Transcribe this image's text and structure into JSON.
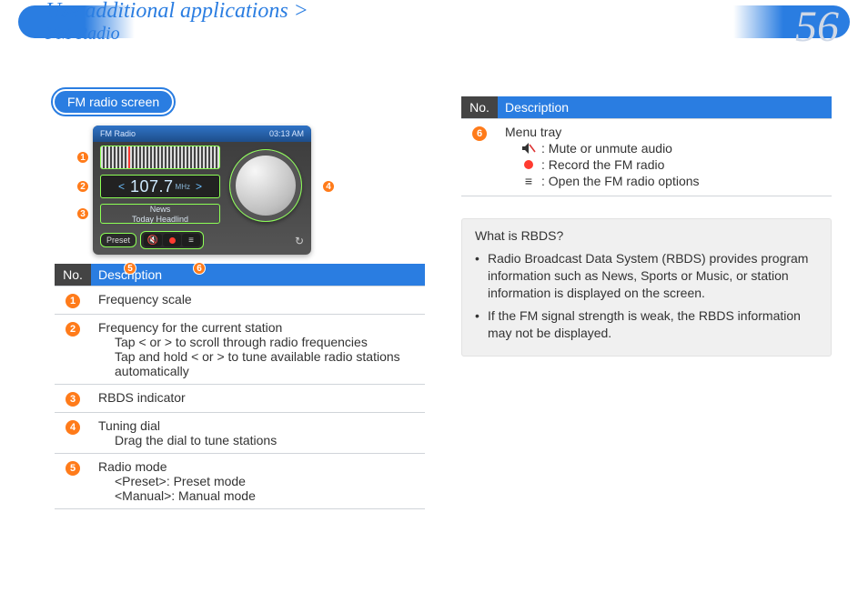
{
  "page": {
    "number": "56"
  },
  "breadcrumb": {
    "main": "Use additional applications >",
    "sub": "FM Radio"
  },
  "section_title": "FM radio screen",
  "radio": {
    "title": "FM Radio",
    "time": "03:13 AM",
    "freq_value": "107.7",
    "freq_unit": "MHz",
    "rbds_line1": "News",
    "rbds_line2": "Today Headlind",
    "mode_label": "Preset",
    "mute_glyph": "🔇",
    "options_glyph": "≡",
    "loop_glyph": "↻"
  },
  "table1": {
    "head_no": "No.",
    "head_desc": "Description",
    "rows": [
      {
        "n": "1",
        "lines": [
          "Frequency scale"
        ]
      },
      {
        "n": "2",
        "lines": [
          "Frequency for the current station",
          "Tap < or > to scroll through radio frequencies",
          "Tap and hold < or > to tune available radio stations automatically"
        ]
      },
      {
        "n": "3",
        "lines": [
          "RBDS indicator"
        ]
      },
      {
        "n": "4",
        "lines": [
          "Tuning dial",
          "Drag the dial to tune stations"
        ]
      },
      {
        "n": "5",
        "lines": [
          "Radio mode",
          "<Preset>: Preset mode",
          "<Manual>: Manual mode"
        ]
      }
    ]
  },
  "table2": {
    "head_no": "No.",
    "head_desc": "Description",
    "row": {
      "n": "6",
      "title": "Menu tray",
      "items": [
        {
          "icon": "mute",
          "text": ": Mute or unmute audio"
        },
        {
          "icon": "rec",
          "text": ": Record the FM radio"
        },
        {
          "icon": "opt",
          "text": ": Open the FM radio options"
        }
      ]
    }
  },
  "infobox": {
    "title": "What is RBDS?",
    "items": [
      "Radio Broadcast Data System (RBDS) provides program information such as News, Sports or Music, or station information is displayed on the screen.",
      "If the FM signal strength is weak, the RBDS information may not be displayed."
    ]
  }
}
